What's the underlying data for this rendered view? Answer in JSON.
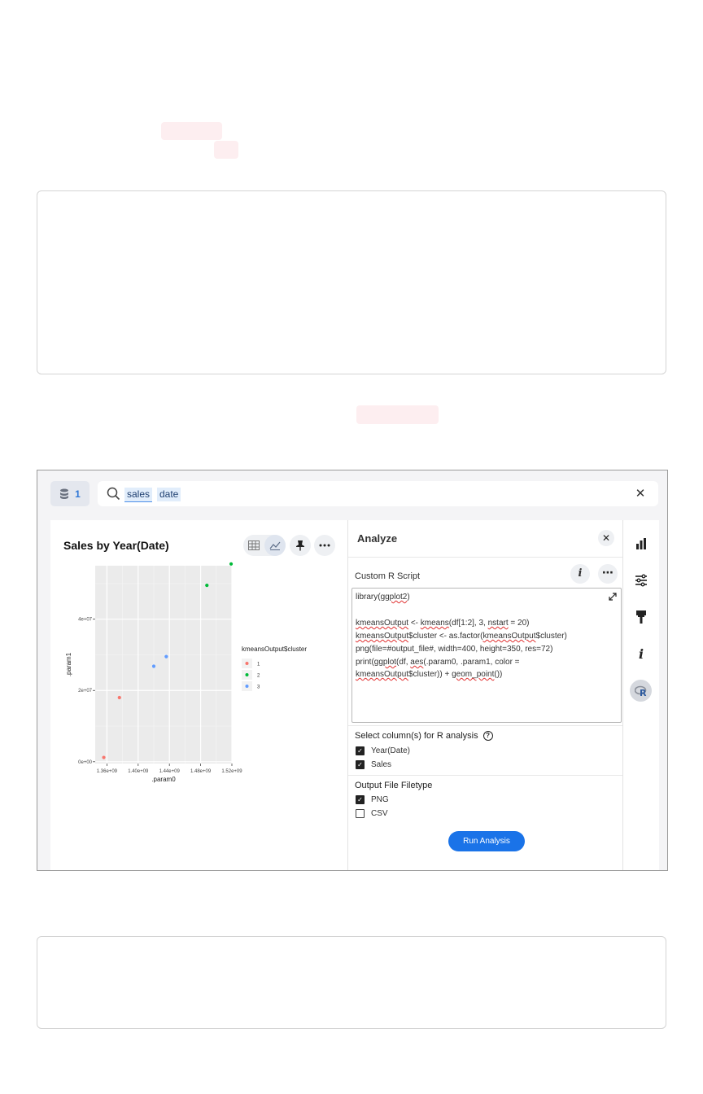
{
  "toolbar": {
    "source_count": "1",
    "search_tokens": [
      "sales",
      "date"
    ]
  },
  "chart": {
    "title": "Sales by Year(Date)",
    "icons": {
      "table": "table-icon",
      "chart": "line-chart-icon",
      "pin": "pin-icon",
      "more": "more-icon"
    }
  },
  "chart_data": {
    "type": "scatter",
    "title": "",
    "xlabel": ".param0",
    "ylabel": ".param1",
    "xlim": [
      1345000000,
      1520000000
    ],
    "ylim": [
      -500000,
      55000000
    ],
    "x_ticks": [
      1360000000,
      1400000000,
      1440000000,
      1480000000,
      1520000000
    ],
    "x_tick_labels": [
      "1.36e+09",
      "1.40e+09",
      "1.44e+09",
      "1.48e+09",
      "1.52e+09"
    ],
    "y_ticks": [
      0,
      20000000,
      40000000
    ],
    "y_tick_labels": [
      "0e+00",
      "2e+07",
      "4e+07"
    ],
    "grid": true,
    "legend": {
      "title": "kmeansOutput$cluster",
      "placement": "right"
    },
    "series": [
      {
        "name": "1",
        "color": "#f8766d",
        "points": [
          [
            1356000000,
            1200000
          ],
          [
            1376000000,
            18000000
          ]
        ]
      },
      {
        "name": "2",
        "color": "#00ba38",
        "points": [
          [
            1488000000,
            49500000
          ],
          [
            1519000000,
            55500000
          ]
        ]
      },
      {
        "name": "3",
        "color": "#619cff",
        "points": [
          [
            1420000000,
            26800000
          ],
          [
            1436000000,
            29500000
          ]
        ]
      }
    ]
  },
  "analyze": {
    "title": "Analyze",
    "script_label": "Custom R Script",
    "script": {
      "l1a": "library(",
      "l1b": "ggplot2",
      "l1c": ")",
      "l2a": "kmeansOutput",
      "l2b": " <- ",
      "l2c": "kmeans",
      "l2d": "(df[1:2], 3, ",
      "l2e": "nstart",
      "l2f": " = 20)",
      "l3a": "kmeansOutput",
      "l3b": "$cluster <- as.factor(",
      "l3c": "kmeansOutput",
      "l3d": "$cluster)",
      "l4": "png(file=#output_file#, width=400, height=350, res=72)",
      "l5a": "print(",
      "l5b": "ggplot",
      "l5c": "(df, ",
      "l5d": "aes",
      "l5e": "(.param0, .param1, color =",
      "l6a": "kmeansOutput",
      "l6b": "$cluster)) + ",
      "l6c": "geom_point",
      "l6d": "())"
    },
    "columns_label": "Select column(s) for R analysis",
    "columns": [
      {
        "label": "Year(Date)",
        "checked": true
      },
      {
        "label": "Sales",
        "checked": true
      }
    ],
    "filetype_label": "Output File Filetype",
    "filetypes": [
      {
        "label": "PNG",
        "checked": true
      },
      {
        "label": "CSV",
        "checked": false
      }
    ],
    "run_label": "Run Analysis"
  },
  "rail_icons": [
    "bar-chart-icon",
    "sliders-icon",
    "brush-icon",
    "info-icon",
    "r-script-icon"
  ]
}
